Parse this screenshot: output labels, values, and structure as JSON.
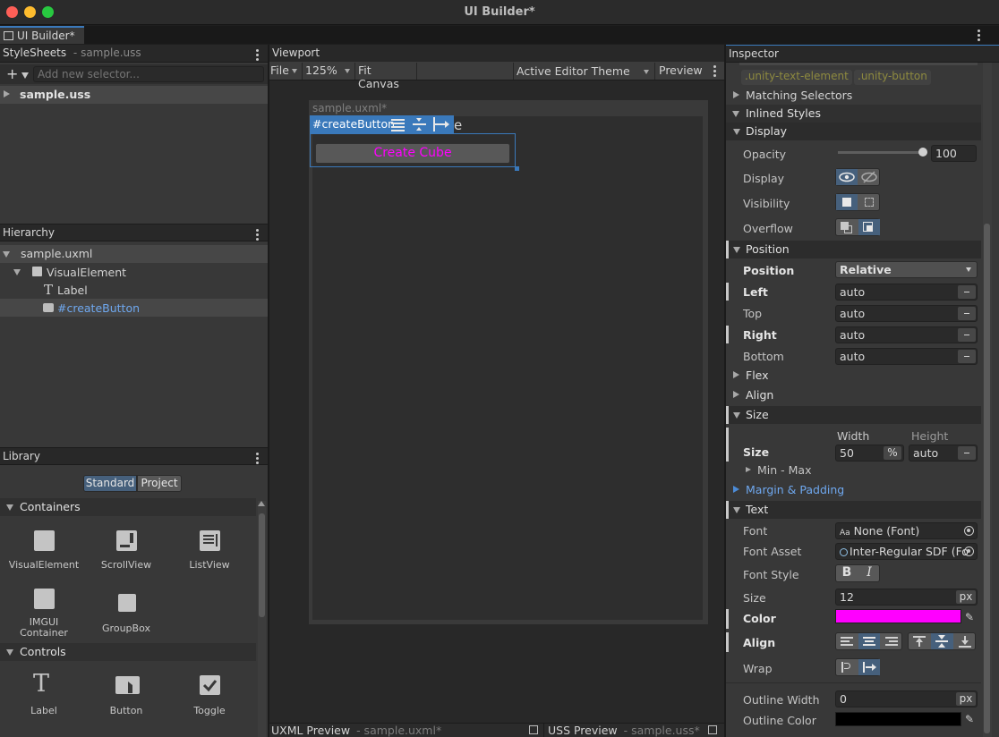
{
  "window": {
    "title": "UI Builder*",
    "tab": "UI Builder*"
  },
  "stylesheets": {
    "title": "StyleSheets",
    "subtitle": "- sample.uss",
    "add_placeholder": "Add new selector...",
    "file": "sample.uss"
  },
  "hierarchy": {
    "title": "Hierarchy",
    "root": "sample.uxml",
    "items": [
      "VisualElement",
      "Label",
      "#createButton"
    ]
  },
  "library": {
    "title": "Library",
    "tabs": [
      "Standard",
      "Project"
    ],
    "containers_title": "Containers",
    "containers": [
      "VisualElement",
      "ScrollView",
      "ListView",
      "IMGUI Container",
      "GroupBox"
    ],
    "controls_title": "Controls",
    "controls": [
      "Label",
      "Button",
      "Toggle"
    ]
  },
  "viewport": {
    "title": "Viewport",
    "file_menu": "File",
    "zoom": "125%",
    "fit": "Fit Canvas",
    "theme": "Active Editor Theme",
    "preview": "Preview",
    "doc_name": "sample.uxml*",
    "selection_name": "#createButton",
    "hidden_char": "e",
    "button_text": "Create Cube"
  },
  "bottom": {
    "uxml_title": "UXML Preview",
    "uxml_file": "- sample.uxml*",
    "uss_title": "USS Preview",
    "uss_file": "- sample.uss*"
  },
  "inspector": {
    "title": "Inspector",
    "classes": [
      ".unity-text-element",
      ".unity-button"
    ],
    "matching": "Matching Selectors",
    "inlined": "Inlined Styles",
    "display_section": "Display",
    "opacity_label": "Opacity",
    "opacity_value": "100",
    "opacity_level": 1.0,
    "display_label": "Display",
    "visibility_label": "Visibility",
    "overflow_label": "Overflow",
    "position_section": "Position",
    "position_label": "Position",
    "position_value": "Relative",
    "left_label": "Left",
    "left_value": "auto",
    "top_label": "Top",
    "top_value": "auto",
    "right_label": "Right",
    "right_value": "auto",
    "bottom_label": "Bottom",
    "bottom_value": "auto",
    "flex_section": "Flex",
    "align_section": "Align",
    "size_section": "Size",
    "size_label": "Size",
    "width_label": "Width",
    "width_value": "50",
    "width_unit": "%",
    "height_label": "Height",
    "height_value": "auto",
    "minmax": "Min - Max",
    "margin_section": "Margin & Padding",
    "text_section": "Text",
    "font_label": "Font",
    "font_value": "None (Font)",
    "font_asset_label": "Font Asset",
    "font_asset_value": "Inter-Regular SDF (Fo",
    "font_style_label": "Font Style",
    "text_size_label": "Size",
    "text_size_value": "12",
    "text_size_unit": "px",
    "color_label": "Color",
    "color_value": "#ff00ff",
    "align_label": "Align",
    "wrap_label": "Wrap",
    "outline_width_label": "Outline Width",
    "outline_width_value": "0",
    "outline_width_unit": "px",
    "outline_color_label": "Outline Color",
    "outline_color_value": "#000000"
  },
  "colors": {
    "accent": "#3a79bb",
    "magenta": "#ff00ff",
    "link": "#6fa8ef"
  }
}
